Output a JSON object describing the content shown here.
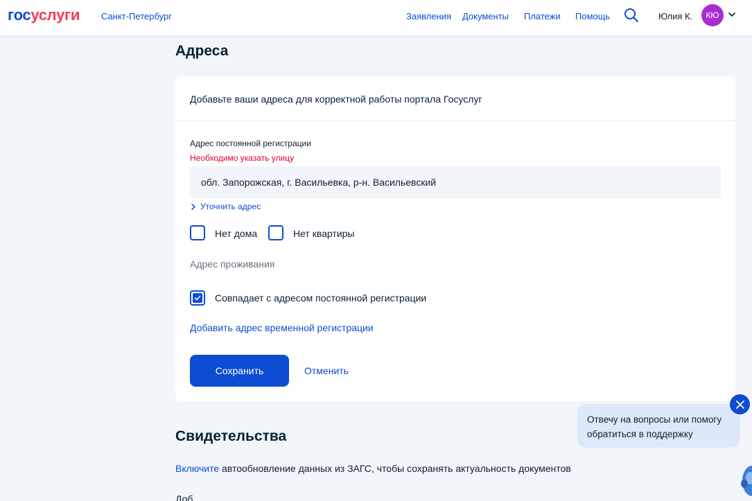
{
  "header": {
    "logo_part1": "гос",
    "logo_part2": "услуги",
    "region": "Санкт-Петербург",
    "nav": [
      "Заявления",
      "Документы",
      "Платежи",
      "Помощь"
    ],
    "user_name": "Юлия К.",
    "avatar_initials": "КЮ",
    "icons": {
      "search": "search-icon",
      "user_menu": "chevron-down-icon"
    }
  },
  "addresses": {
    "title": "Адреса",
    "intro": "Добавьте ваши адреса для корректной работы портала Госуслуг",
    "registration": {
      "label": "Адрес постоянной регистрации",
      "error": "Необходимо указать улицу",
      "value": "обл. Запорожская, г. Васильевка, р-н. Васильевский",
      "refine_link": "Уточнить адрес"
    },
    "checkboxes": {
      "no_house": "Нет дома",
      "no_apartment": "Нет квартиры"
    },
    "residence": {
      "label": "Адрес проживания",
      "same_as_registration": "Совпадает с адресом постоянной регистрации",
      "same_checked": true
    },
    "add_temp_link": "Добавить адрес временной регистрации",
    "save_button": "Сохранить",
    "cancel_link": "Отменить"
  },
  "certificates": {
    "title": "Свидетельства",
    "enable_link": "Включите",
    "text": " автообновление данных из ЗАГС, чтобы сохранять актуальность документов",
    "partial_next": "Доб"
  },
  "chat": {
    "message": "Отвечу на вопросы или помогу обратиться в поддержку"
  },
  "colors": {
    "brand_blue": "#0d4cd3",
    "brand_red": "#ee3f58",
    "error_red": "#e2002a",
    "avatar_purple": "#a92bd1",
    "page_bg": "#f2f5f9"
  }
}
